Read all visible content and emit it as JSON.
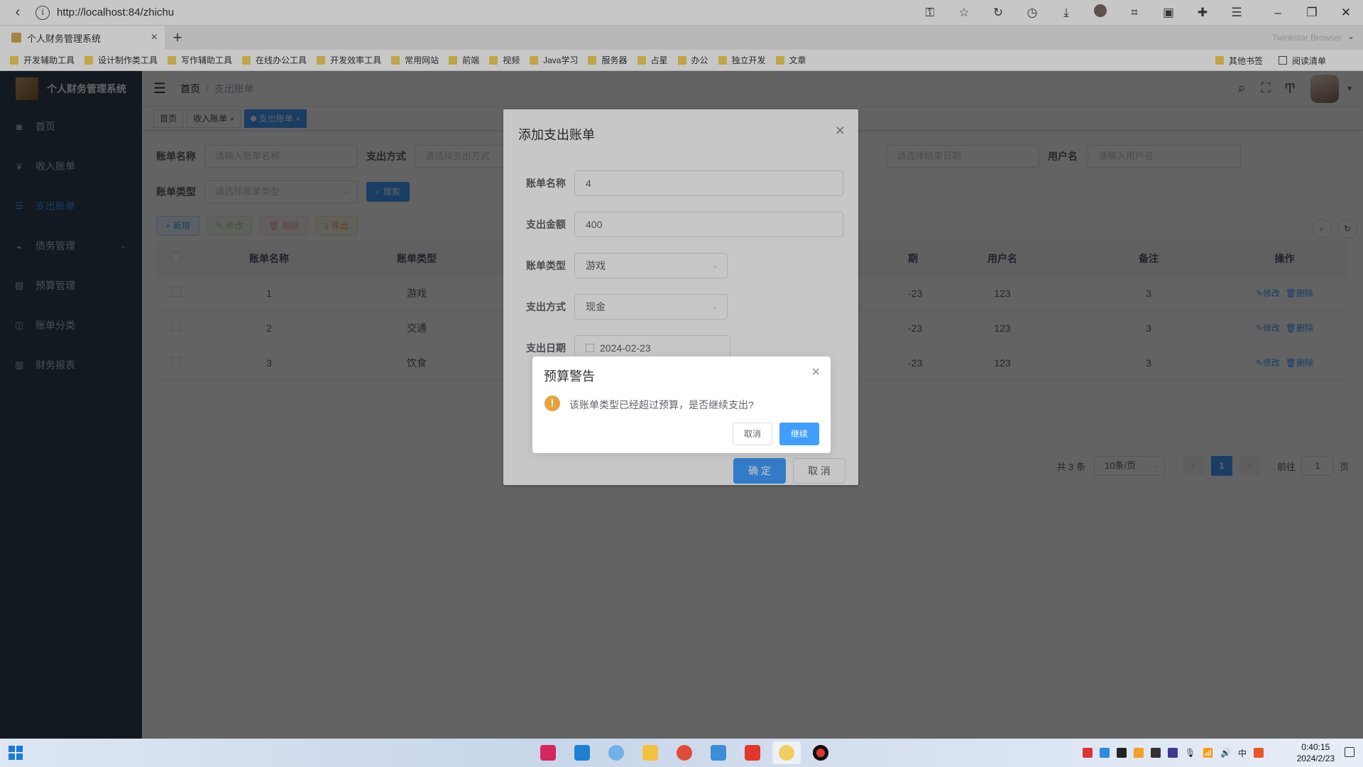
{
  "browser": {
    "url": "http://localhost:84/zhichu",
    "tab_title": "个人财务管理系统",
    "brand": "Twinkstar Browser",
    "bookmarks": [
      "开发辅助工具",
      "设计制作类工具",
      "写作辅助工具",
      "在线办公工具",
      "开发效率工具",
      "常用网站",
      "前端",
      "视频",
      "Java学习",
      "服务器",
      "占星",
      "办公",
      "独立开发",
      "文章"
    ],
    "bookmarks_right": [
      "其他书签",
      "阅读清单"
    ]
  },
  "sidebar": {
    "title": "个人财务管理系统",
    "items": [
      {
        "label": "首页",
        "icon": "dashboard-icon"
      },
      {
        "label": "收入账单",
        "icon": "yen-icon"
      },
      {
        "label": "支出账单",
        "icon": "list-icon"
      },
      {
        "label": "债务管理",
        "icon": "debt-icon"
      },
      {
        "label": "预算管理",
        "icon": "budget-icon"
      },
      {
        "label": "账单分类",
        "icon": "category-icon"
      },
      {
        "label": "财务报表",
        "icon": "chart-icon"
      }
    ]
  },
  "navbar": {
    "breadcrumb": [
      "首页",
      "支出账单"
    ]
  },
  "tags": [
    "首页",
    "收入账单",
    "支出账单"
  ],
  "search": {
    "labels": {
      "name": "账单名称",
      "method": "支出方式",
      "username": "用户名",
      "type": "账单类型"
    },
    "placeholders": {
      "name": "请输入账单名称",
      "method": "请选择支出方式",
      "end_date": "请选择结束日期",
      "username": "请输入用户名",
      "type": "请选择账单类型"
    },
    "search_btn": "搜索"
  },
  "toolbar": {
    "add": "新增",
    "edit": "修改",
    "delete": "删除",
    "export": "导出"
  },
  "table": {
    "headers": [
      "账单名称",
      "账单类型",
      "期",
      "用户名",
      "备注",
      "操作"
    ],
    "rows": [
      {
        "name": "1",
        "type": "游戏",
        "date": "-23",
        "user": "123",
        "note": "3"
      },
      {
        "name": "2",
        "type": "交通",
        "date": "-23",
        "user": "123",
        "note": "3"
      },
      {
        "name": "3",
        "type": "饮食",
        "date": "-23",
        "user": "123",
        "note": "3"
      }
    ],
    "op_edit": "修改",
    "op_delete": "删除"
  },
  "pagination": {
    "total": "共 3 条",
    "size": "10条/页",
    "page": "1",
    "goto": "前往",
    "goto_value": "1",
    "page_suffix": "页"
  },
  "dialog": {
    "title": "添加支出账单",
    "fields": {
      "name_label": "账单名称",
      "name_value": "4",
      "amount_label": "支出金额",
      "amount_value": "400",
      "type_label": "账单类型",
      "type_value": "游戏",
      "method_label": "支出方式",
      "method_value": "现金",
      "date_label": "支出日期",
      "date_value": "2024-02-23"
    },
    "ok": "确 定",
    "cancel": "取 消"
  },
  "msgbox": {
    "title": "预算警告",
    "text": "该账单类型已经超过预算，是否继续支出?",
    "cancel": "取消",
    "ok": "继续"
  },
  "taskbar": {
    "time": "0:40:15",
    "date": "2024/2/23"
  },
  "colors": {
    "primary": "#409eff",
    "sidebar": "#304156",
    "warning": "#e6a23c"
  }
}
